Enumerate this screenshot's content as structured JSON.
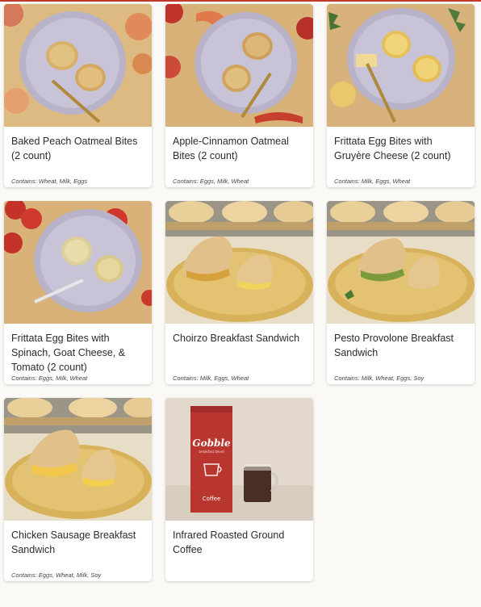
{
  "products": [
    {
      "title": "Baked Peach Oatmeal Bites (2 count)",
      "contains": "Contains: Wheat, Milk, Eggs",
      "image": "oatmeal-bites-peach"
    },
    {
      "title": "Apple-Cinnamon Oatmeal Bites (2 count)",
      "contains": "Contains: Eggs, Milk, Wheat",
      "image": "oatmeal-bites-apple"
    },
    {
      "title": "Frittata Egg Bites with Gruyère Cheese (2 count)",
      "contains": "Contains: Milk, Eggs, Wheat",
      "image": "egg-bites-gruyere"
    },
    {
      "title": "Frittata Egg Bites with Spinach, Goat Cheese, & Tomato (2 count)",
      "contains": "Contains: Eggs, Milk, Wheat",
      "image": "egg-bites-spinach"
    },
    {
      "title": "Choirzo Breakfast Sandwich",
      "contains": "Contains: Milk, Eggs, Wheat",
      "image": "sandwich-chorizo"
    },
    {
      "title": "Pesto Provolone Breakfast Sandwich",
      "contains": "Contains: Milk, Wheat, Eggs, Soy",
      "image": "sandwich-pesto"
    },
    {
      "title": "Chicken Sausage Breakfast Sandwich",
      "contains": "Contains: Eggs, Wheat, Milk, Soy",
      "image": "sandwich-chicken"
    },
    {
      "title": "Infrared Roasted Ground Coffee",
      "contains": "",
      "image": "coffee-bag"
    }
  ],
  "coffee_bag": {
    "brand": "Gobble",
    "subbrand": "breakfast blend",
    "label": "Coffee"
  },
  "colors": {
    "accent": "#c0392b",
    "card_bg": "#ffffff",
    "page_bg": "#fbf9f5",
    "text": "#2b2b2b"
  }
}
